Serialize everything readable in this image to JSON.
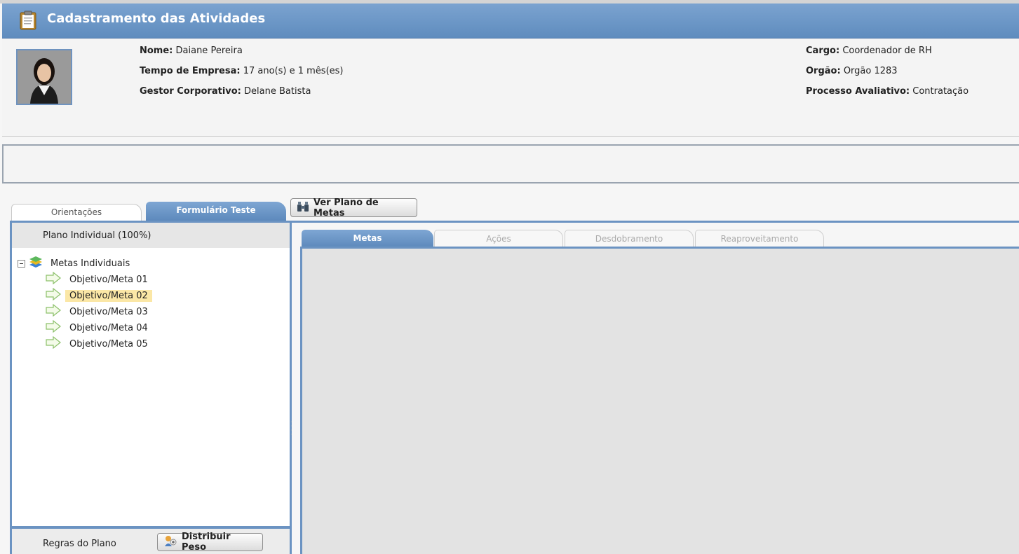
{
  "header": {
    "title": "Cadastramento das Atividades",
    "icon": "clipboard-icon"
  },
  "profile": {
    "name_label": "Nome:",
    "name_value": "Daiane Pereira",
    "tenure_label": "Tempo de Empresa:",
    "tenure_value": "17 ano(s) e 1 mês(es)",
    "manager_label": "Gestor Corporativo:",
    "manager_value": "Delane Batista",
    "role_label": "Cargo:",
    "role_value": "Coordenador de RH",
    "org_label": "Orgão:",
    "org_value": "Orgão 1283",
    "process_label": "Processo Avaliativo:",
    "process_value": "Contratação"
  },
  "outer_tabs": [
    {
      "label": "Orientações",
      "active": false
    },
    {
      "label": "Formulário Teste",
      "active": true
    }
  ],
  "toolbar": {
    "plano_button": "Ver Plano de Metas",
    "plano_icon": "binoculars-icon"
  },
  "left_panel": {
    "header": "Plano Individual (100%)",
    "tree": {
      "root_label": "Metas Individuais",
      "root_icon": "layers-icon",
      "items": [
        {
          "label": "Objetivo/Meta 01",
          "selected": false
        },
        {
          "label": "Objetivo/Meta 02",
          "selected": true
        },
        {
          "label": "Objetivo/Meta 03",
          "selected": false
        },
        {
          "label": "Objetivo/Meta 04",
          "selected": false
        },
        {
          "label": "Objetivo/Meta 05",
          "selected": false
        }
      ]
    },
    "footer_label": "Regras do Plano",
    "distribute_button": "Distribuir Peso",
    "distribute_icon": "weight-distribute-icon"
  },
  "inner_tabs": [
    {
      "label": "Metas",
      "active": true
    },
    {
      "label": "Ações",
      "active": false
    },
    {
      "label": "Desdobramento",
      "active": false
    },
    {
      "label": "Reaproveitamento",
      "active": false
    }
  ],
  "colors": {
    "accent": "#6b93c2",
    "header_top": "#7ba3d0",
    "selected": "#fbe7a6"
  }
}
